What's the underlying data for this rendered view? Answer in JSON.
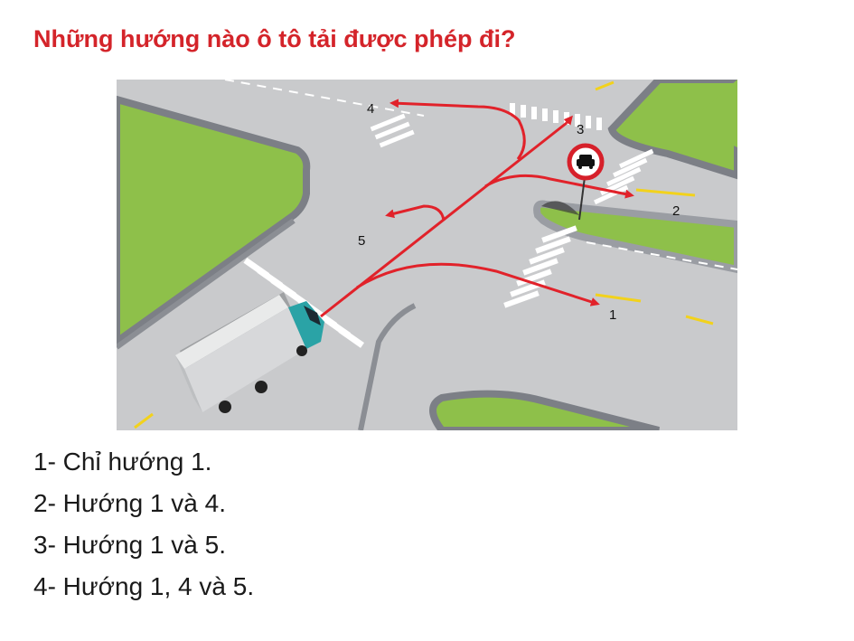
{
  "question": "Những hướng nào ô tô tải được phép đi?",
  "figure": {
    "direction_labels": [
      "1",
      "2",
      "3",
      "4",
      "5"
    ],
    "sign": "no-entry-for-cars-sign",
    "vehicle": "truck-icon",
    "colors": {
      "arrow": "#e1222a",
      "road": "#c9cacc",
      "grass": "#8ec04a",
      "sign_border": "#d6202a",
      "lane_line": "#f2d21c"
    }
  },
  "answers": [
    "1- Chỉ hướng 1.",
    "2- Hướng 1 và 4.",
    "3- Hướng 1 và 5.",
    "4- Hướng 1, 4 và 5."
  ]
}
